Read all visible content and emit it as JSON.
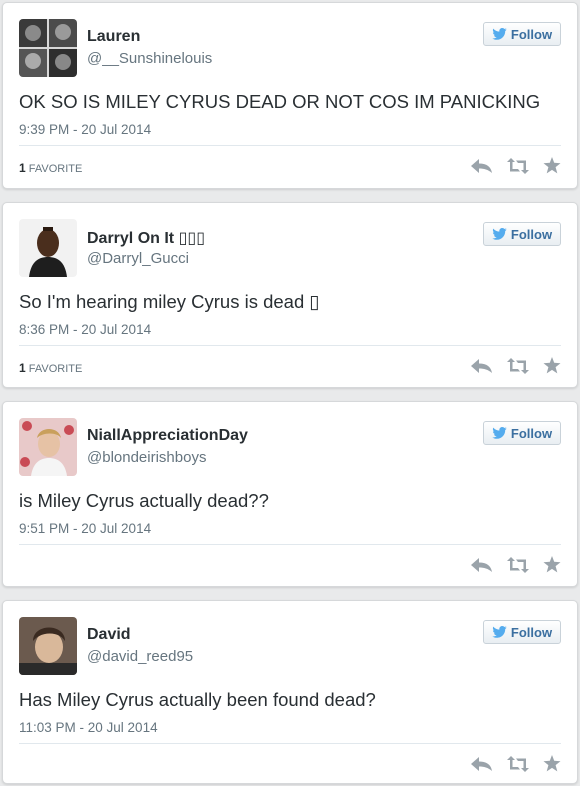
{
  "tweets": [
    {
      "name": "Lauren",
      "handle": "@__Sunshinelouis",
      "text": "OK SO IS MILEY CYRUS DEAD OR NOT COS IM PANICKING",
      "timestamp": "9:39 PM - 20 Jul 2014",
      "favorites_count": "1",
      "favorites_label": "FAVORITE",
      "follow_label": "Follow"
    },
    {
      "name": "Darryl On It ▯▯▯",
      "handle": "@Darryl_Gucci",
      "text": "So I'm hearing miley Cyrus is dead ▯",
      "timestamp": "8:36 PM - 20 Jul 2014",
      "favorites_count": "1",
      "favorites_label": "FAVORITE",
      "follow_label": "Follow"
    },
    {
      "name": "NiallAppreciationDay",
      "handle": "@blondeirishboys",
      "text": "is Miley Cyrus actually dead??",
      "timestamp": "9:51 PM - 20 Jul 2014",
      "follow_label": "Follow"
    },
    {
      "name": "David",
      "handle": "@david_reed95",
      "text": "Has Miley Cyrus actually been found dead?",
      "timestamp": "11:03 PM - 20 Jul 2014",
      "follow_label": "Follow"
    }
  ],
  "icons": {
    "follow": "bird-icon",
    "reply": "reply-icon",
    "retweet": "retweet-icon",
    "favorite": "star-icon"
  },
  "colors": {
    "accent": "#3b6fa0",
    "bird": "#55acee",
    "action_icon": "#9aa3aa"
  }
}
